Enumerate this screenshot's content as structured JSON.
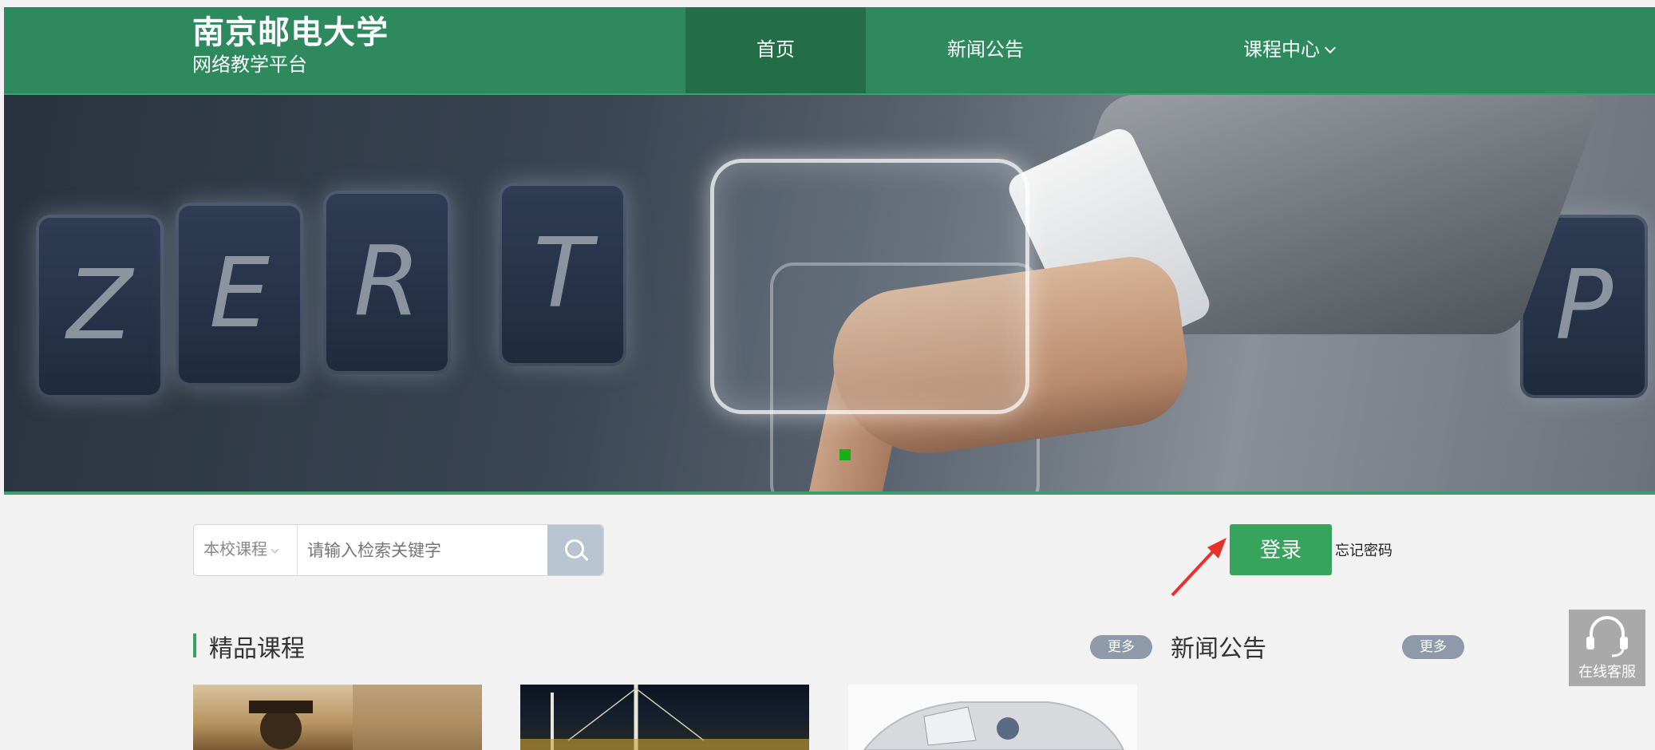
{
  "brand": {
    "title": "南京邮电大学",
    "subtitle": "网络教学平台"
  },
  "nav": {
    "items": [
      {
        "label": "首页"
      },
      {
        "label": "新闻公告"
      },
      {
        "label": "课程中心"
      }
    ]
  },
  "banner": {
    "keys": [
      "Z",
      "E",
      "R",
      "T",
      "P"
    ]
  },
  "search": {
    "category": "本校课程",
    "placeholder": "请输入检索关键字"
  },
  "login": {
    "button": "登录",
    "forgot": "忘记密码"
  },
  "sections": {
    "featured": {
      "title": "精品课程",
      "more": "更多"
    },
    "news": {
      "title": "新闻公告",
      "more": "更多"
    }
  },
  "support": {
    "label": "在线客服"
  },
  "colors": {
    "primary": "#2e8a5e",
    "active_nav": "#236e48",
    "login": "#37a35d",
    "more_badge": "#8e9aa9"
  }
}
